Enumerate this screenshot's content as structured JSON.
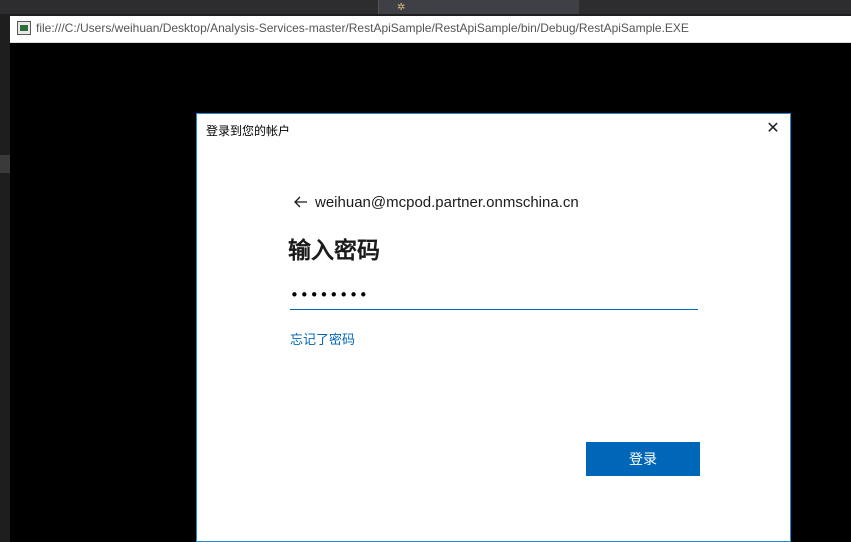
{
  "console_window": {
    "title": "file:///C:/Users/weihuan/Desktop/Analysis-Services-master/RestApiSample/RestApiSample/bin/Debug/RestApiSample.EXE"
  },
  "dialog": {
    "title": "登录到您的帐户",
    "close_icon": "close-icon",
    "account_email": "weihuan@mcpod.partner.onmschina.cn",
    "back_icon": "arrow-left-icon",
    "heading": "输入密码",
    "password_masked": "••••••••",
    "forgot_password_label": "忘记了密码",
    "signin_label": "登录"
  },
  "colors": {
    "accent": "#0067b8",
    "dialog_border": "#1e8ad6",
    "console_bg": "#000000"
  }
}
